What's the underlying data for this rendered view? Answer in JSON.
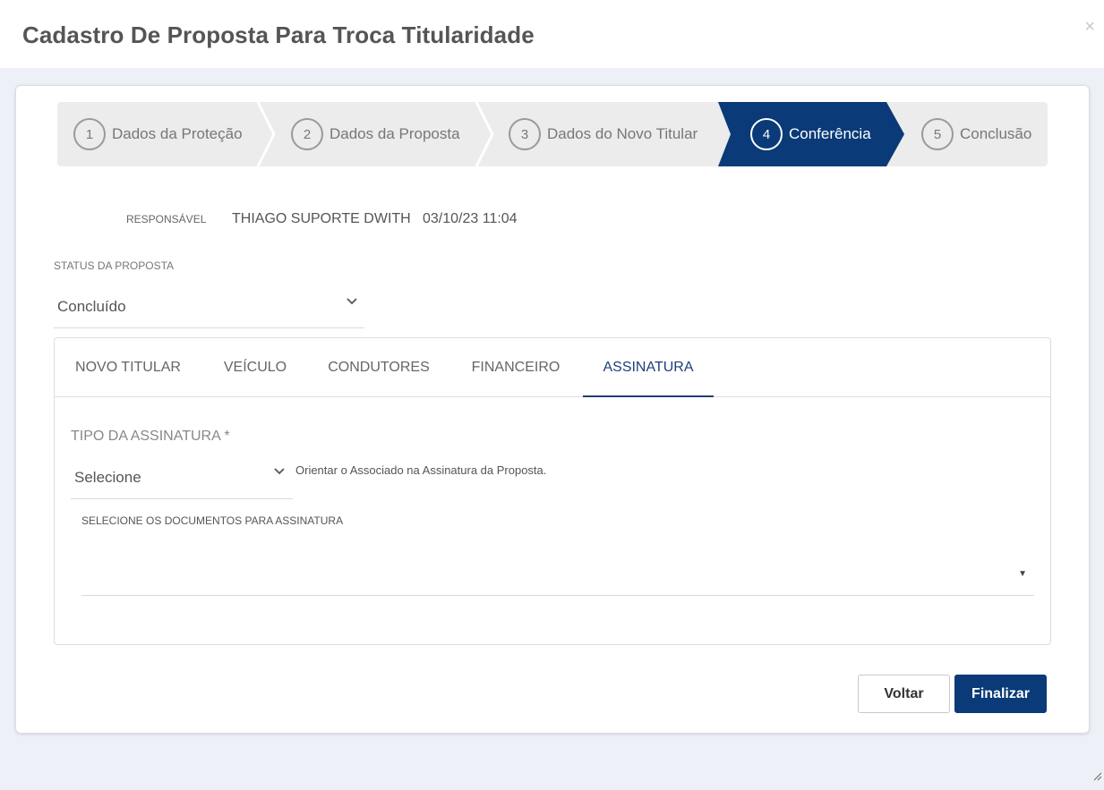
{
  "modal": {
    "title": "Cadastro De Proposta Para Troca Titularidade",
    "close_glyph": "×"
  },
  "stepper": {
    "active_index": 3,
    "active_color": "#0a3a78",
    "steps": [
      {
        "number": "1",
        "label": "Dados da Proteção"
      },
      {
        "number": "2",
        "label": "Dados da Proposta"
      },
      {
        "number": "3",
        "label": "Dados do Novo Titular"
      },
      {
        "number": "4",
        "label": "Conferência"
      },
      {
        "number": "5",
        "label": "Conclusão"
      }
    ]
  },
  "responsavel": {
    "label": "RESPONSÁVEL",
    "name": "THIAGO SUPORTE DWITH",
    "datetime": "03/10/23 11:04"
  },
  "status": {
    "label": "STATUS DA PROPOSTA",
    "value": "Concluído"
  },
  "tabs": {
    "active_index": 4,
    "items": [
      {
        "label": "NOVO TITULAR"
      },
      {
        "label": "VEÍCULO"
      },
      {
        "label": "CONDUTORES"
      },
      {
        "label": "FINANCEIRO"
      },
      {
        "label": "ASSINATURA"
      }
    ]
  },
  "assinatura": {
    "tipo_label": "TIPO DA ASSINATURA",
    "required_mark": "*",
    "tipo_value": "Selecione",
    "hint": "Orientar o Associado na Assinatura da Proposta.",
    "docs_label": "SELECIONE OS DOCUMENTOS PARA ASSINATURA",
    "docs_value": ""
  },
  "buttons": {
    "back": "Voltar",
    "finish": "Finalizar"
  },
  "colors": {
    "primary": "#0a3a78",
    "tab_active": "#1e3f7a"
  },
  "icons": {
    "close": "close-icon",
    "dropdown": "chevron-down-icon",
    "caret": "caret-down-icon",
    "resize": "resize-grip-icon"
  }
}
